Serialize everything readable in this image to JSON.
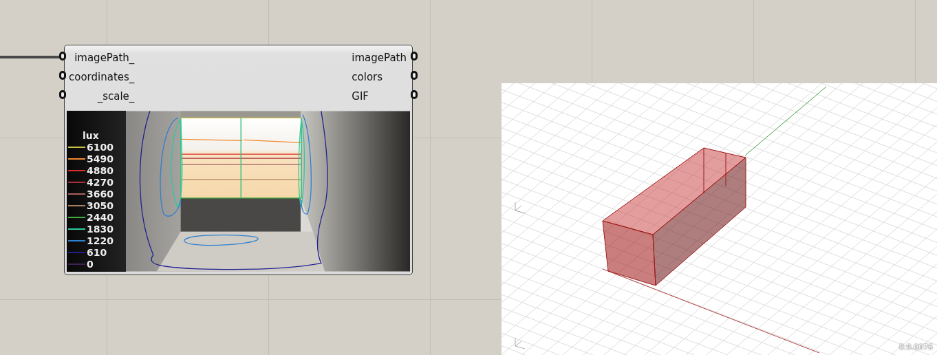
{
  "component": {
    "inputs": [
      "imagePath_",
      "coordinates_",
      "_scale_"
    ],
    "outputs": [
      "imagePath",
      "colors",
      "GIF"
    ],
    "legend": {
      "title": "lux",
      "entries": [
        {
          "label": "6100",
          "color": "#c8c040"
        },
        {
          "label": "5490",
          "color": "#f08a30"
        },
        {
          "label": "4880",
          "color": "#d83030"
        },
        {
          "label": "4270",
          "color": "#a83038"
        },
        {
          "label": "3660",
          "color": "#a86060"
        },
        {
          "label": "3050",
          "color": "#a88060"
        },
        {
          "label": "2440",
          "color": "#40b040"
        },
        {
          "label": "1830",
          "color": "#30c8a0"
        },
        {
          "label": "1220",
          "color": "#3080d0"
        },
        {
          "label": "610",
          "color": "#202090"
        },
        {
          "label": "0",
          "color": "#402058"
        }
      ]
    }
  },
  "viewport": {
    "version": "0.9.0076"
  }
}
